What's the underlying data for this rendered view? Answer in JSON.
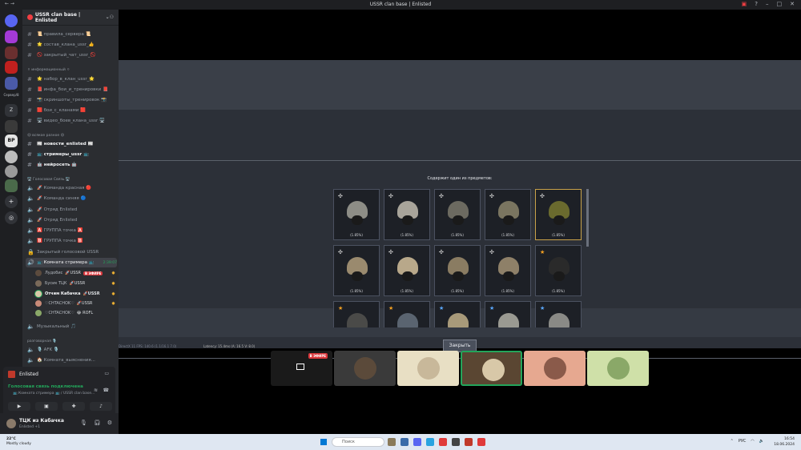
{
  "window": {
    "title": "USSR clan base | Enlisted",
    "nav": "←  →"
  },
  "rail": {
    "folder_label": "Сервер/8",
    "z_label": "Z",
    "bp_label": "BP"
  },
  "server": {
    "name": "USSR clan base | Enlisted"
  },
  "channels": [
    {
      "label": "📜 правила_сервера 📜",
      "kind": "text"
    },
    {
      "label": "🌟 состав_клана_ussr_👍",
      "kind": "text"
    },
    {
      "label": "🚫 закрытый_чат_ussr_🚫",
      "kind": "text"
    }
  ],
  "category_info": "⚪ информационный ⚪",
  "info_channels": [
    {
      "label": "🌟 набор_в_клан_ussr_🌟"
    },
    {
      "label": "📕 инфа_бои_и_тренировки 📕"
    },
    {
      "label": "📸 скриншоты_тренировок 📸"
    },
    {
      "label": "🟥 бои_с_кланами 🟥"
    },
    {
      "label": "🖥️ видео_боев_клана_ussr 🖥️"
    }
  ],
  "category_misc": "😃 всякое разное 😃",
  "misc_channels": [
    {
      "label": "📰 новости_enlisted 📰"
    },
    {
      "label": "📺 стримеры_ussr 📺"
    },
    {
      "label": "🤖 нейросеть 🤖"
    }
  ],
  "category_voice": "🖥️ Голосовая Связь 🖥️",
  "voice_channels": [
    {
      "label": "🚀 Команда красная 🔴"
    },
    {
      "label": "🚀 Команда синяя 🔵"
    },
    {
      "label": "🚀 Отряд Enlisted"
    },
    {
      "label": "🚀 Отряд Enlisted"
    },
    {
      "label": "🅰️ ГРУППА точка 🅰️"
    },
    {
      "label": "🅱️ ГРУППА точка 🅱️"
    },
    {
      "label": "Закрытый голосовой USSR"
    }
  ],
  "active_voice": {
    "label": "📺 Комната стримера 📺",
    "timer": "2:39:07"
  },
  "voice_users": [
    {
      "name": "Лудобис",
      "tag": "🚀USSR",
      "live": "В ЭФИРЕ"
    },
    {
      "name": "Бусик ТЦК",
      "tag": "🚀USSR",
      "live": ""
    },
    {
      "name": "Отчим Кабачка",
      "tag": "🚀USSR",
      "live": ""
    },
    {
      "name": "♡CHTACHOK♡",
      "tag": "🚀USSR",
      "live": ""
    },
    {
      "name": "♡CHTACHOK♡",
      "tag": "😂 ROFL",
      "live": ""
    }
  ],
  "music_channel": "Музыкальный 🎵",
  "category_talk": "разговорная 🎙️",
  "talk_channels": [
    {
      "label": "🎙️ AFK 🎙️"
    },
    {
      "label": "🏠 Комната_выяснения..."
    }
  ],
  "activity": {
    "game": "Enlisted",
    "voice_status": "Голосовая связь подключена",
    "voice_sub": "📺 Комната стримера 📺 / USSR clan base..."
  },
  "user": {
    "name": "ТЦК из Кабачка",
    "status": "Enlisted +1"
  },
  "game": {
    "dialog_title": "Содержит один из предметов:",
    "close_label": "Закрыть",
    "stats_line": "DirectX 11 FPS: 140.6 (1.1/16.1 7.0)",
    "latency_line": "Latency: 15.4ms (A: 16.5 V: 8.0)",
    "items": [
      {
        "pct": "(1.85%)",
        "badge": "cross",
        "selected": false,
        "color": "#8d8d86"
      },
      {
        "pct": "(1.85%)",
        "badge": "cross",
        "selected": false,
        "color": "#a8a49a"
      },
      {
        "pct": "(1.85%)",
        "badge": "cross",
        "selected": false,
        "color": "#6c6a60"
      },
      {
        "pct": "(1.85%)",
        "badge": "cross",
        "selected": false,
        "color": "#7a7560"
      },
      {
        "pct": "(1.85%)",
        "badge": "cross",
        "selected": true,
        "color": "#6a6a2e"
      },
      {
        "pct": "(1.85%)",
        "badge": "cross",
        "selected": false,
        "color": "#9a8a6e"
      },
      {
        "pct": "(1.85%)",
        "badge": "cross",
        "selected": false,
        "color": "#b8a88a"
      },
      {
        "pct": "(1.85%)",
        "badge": "cross",
        "selected": false,
        "color": "#8a7c62"
      },
      {
        "pct": "(1.85%)",
        "badge": "cross",
        "selected": false,
        "color": "#8e8068"
      },
      {
        "pct": "(1.85%)",
        "badge": "star",
        "selected": false,
        "color": "#2a2a2a"
      },
      {
        "pct": "",
        "badge": "star",
        "selected": false,
        "color": "#4a4a48"
      },
      {
        "pct": "",
        "badge": "star",
        "selected": false,
        "color": "#5a6470"
      },
      {
        "pct": "",
        "badge": "bstar",
        "selected": false,
        "color": "#a89a7a"
      },
      {
        "pct": "",
        "badge": "bstar",
        "selected": false,
        "color": "#9a9a92"
      },
      {
        "pct": "",
        "badge": "bstar",
        "selected": false,
        "color": "#8a8a86"
      }
    ]
  },
  "tiles": [
    {
      "bg": "#1a1a1a",
      "round": "",
      "live": "В ЭФИРЕ",
      "speaking": false
    },
    {
      "bg": "#3a3a3a",
      "round": "#5b4a3a",
      "live": "",
      "speaking": false
    },
    {
      "bg": "#e8dfc4",
      "round": "#c8b89a",
      "live": "",
      "speaking": false
    },
    {
      "bg": "#5a4632",
      "round": "#d8c8a8",
      "live": "",
      "speaking": true
    },
    {
      "bg": "#e6a890",
      "round": "#8a5a4a",
      "live": "",
      "speaking": false
    },
    {
      "bg": "#cfe0a8",
      "round": "#8aa868",
      "live": "",
      "speaking": false
    }
  ],
  "taskbar": {
    "temp": "22°C",
    "weather": "Mostly cloudy",
    "search_placeholder": "Поиск",
    "lang": "РУС",
    "time": "16:54",
    "date": "18.06.2024"
  },
  "colors": {
    "discord_bg": "#2b2d31",
    "accent_green": "#23a55a",
    "live_red": "#da373c"
  }
}
